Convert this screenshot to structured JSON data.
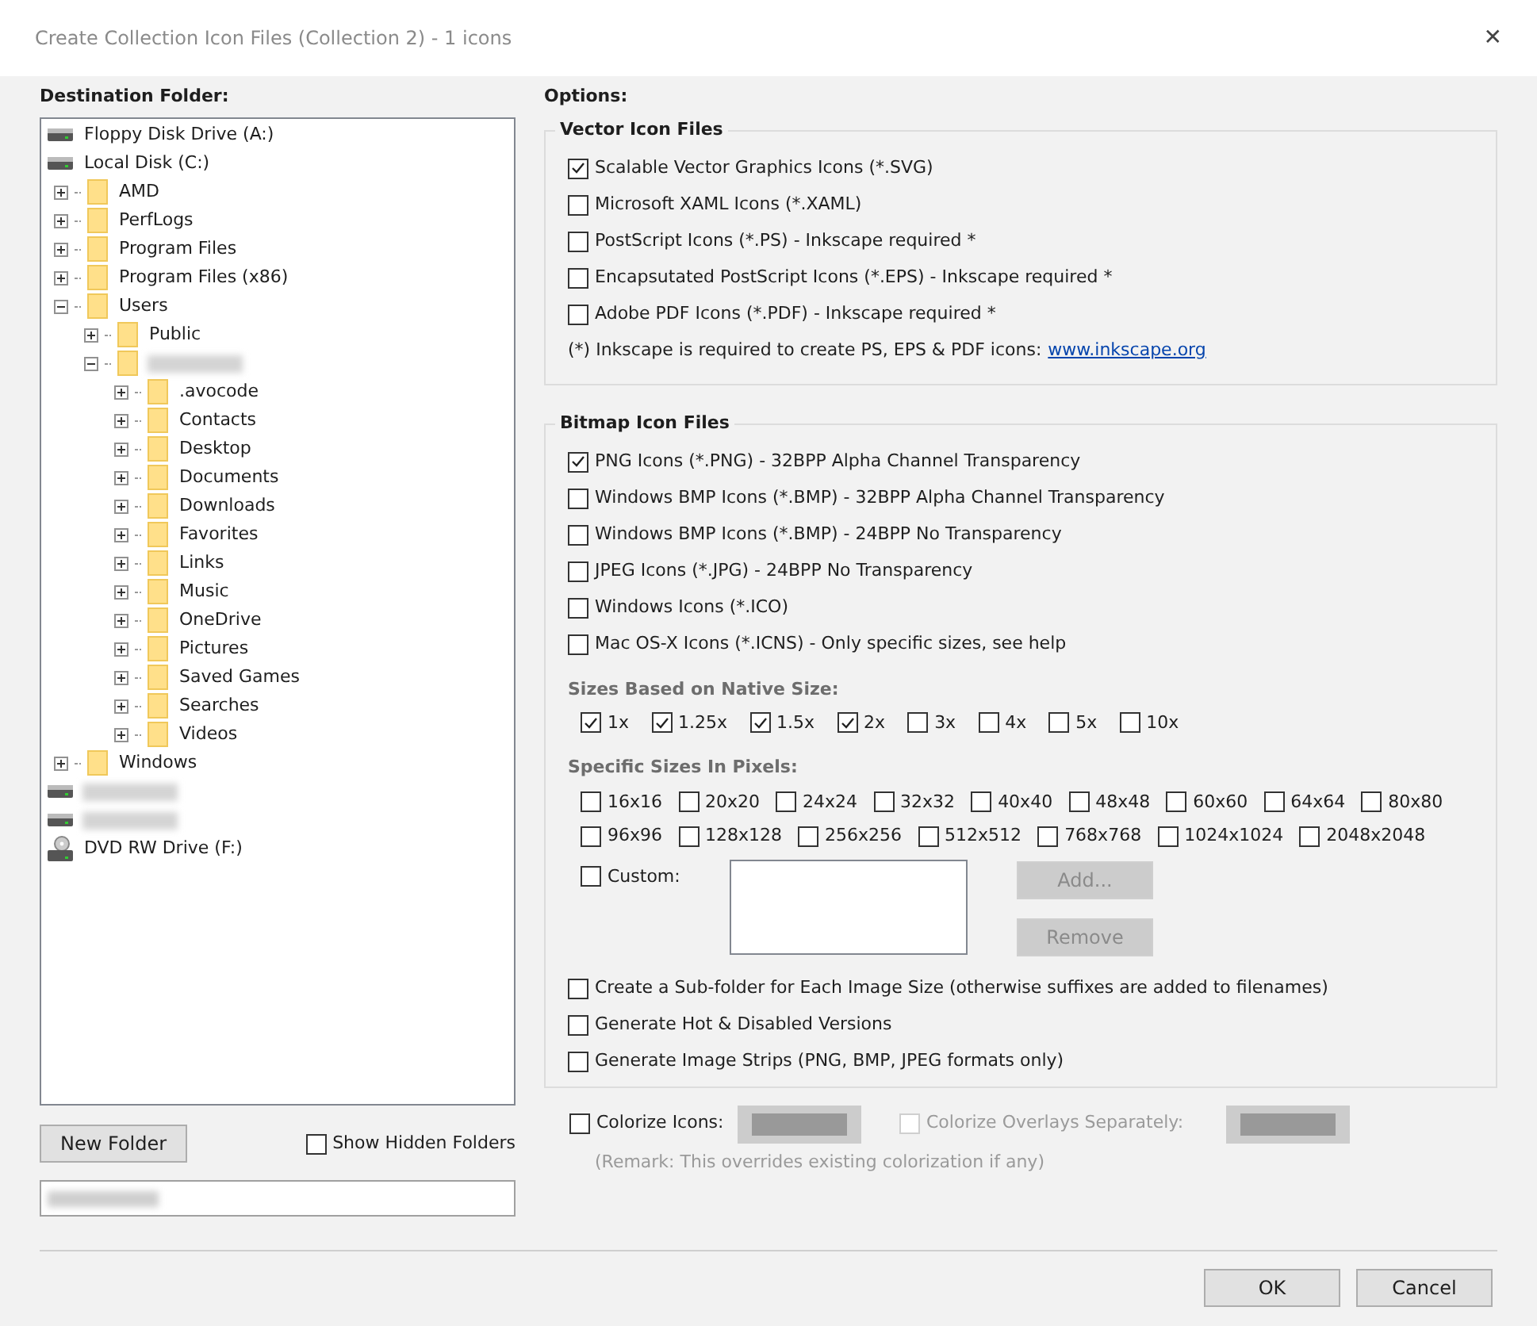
{
  "window": {
    "title": "Create Collection Icon Files (Collection 2) - 1 icons",
    "close": "✕"
  },
  "destination": {
    "label": "Destination Folder:",
    "tree": [
      {
        "kind": "drive",
        "label": "Floppy Disk Drive (A:)"
      },
      {
        "kind": "drive",
        "label": "Local Disk (C:)",
        "children": [
          {
            "kind": "folder",
            "label": "AMD",
            "expanded": false
          },
          {
            "kind": "folder",
            "label": "PerfLogs",
            "expanded": false
          },
          {
            "kind": "folder",
            "label": "Program Files",
            "expanded": false
          },
          {
            "kind": "folder",
            "label": "Program Files (x86)",
            "expanded": false
          },
          {
            "kind": "folder",
            "label": "Users",
            "expanded": true,
            "children": [
              {
                "kind": "folder",
                "label": "Public",
                "expanded": false
              },
              {
                "kind": "folder",
                "redacted": true,
                "expanded": true,
                "children": [
                  {
                    "kind": "folder",
                    "label": ".avocode",
                    "expanded": false
                  },
                  {
                    "kind": "folder",
                    "label": "Contacts",
                    "expanded": false
                  },
                  {
                    "kind": "folder",
                    "label": "Desktop",
                    "expanded": false
                  },
                  {
                    "kind": "folder",
                    "label": "Documents",
                    "expanded": false
                  },
                  {
                    "kind": "folder",
                    "label": "Downloads",
                    "expanded": false
                  },
                  {
                    "kind": "folder",
                    "label": "Favorites",
                    "expanded": false
                  },
                  {
                    "kind": "folder",
                    "label": "Links",
                    "expanded": false
                  },
                  {
                    "kind": "folder",
                    "label": "Music",
                    "expanded": false
                  },
                  {
                    "kind": "folder",
                    "label": "OneDrive",
                    "expanded": false
                  },
                  {
                    "kind": "folder",
                    "label": "Pictures",
                    "expanded": false
                  },
                  {
                    "kind": "folder",
                    "label": "Saved Games",
                    "expanded": false
                  },
                  {
                    "kind": "folder",
                    "label": "Searches",
                    "expanded": false
                  },
                  {
                    "kind": "folder",
                    "label": "Videos",
                    "expanded": false
                  }
                ]
              }
            ]
          },
          {
            "kind": "folder",
            "label": "Windows",
            "expanded": false
          }
        ]
      },
      {
        "kind": "drive",
        "redacted": true
      },
      {
        "kind": "drive",
        "redacted": true
      },
      {
        "kind": "dvd",
        "label": "DVD RW Drive (F:)"
      }
    ],
    "new_folder": "New Folder",
    "show_hidden": {
      "label": "Show Hidden Folders",
      "checked": false
    },
    "path": {
      "redacted": true
    }
  },
  "options": {
    "label": "Options:",
    "vector": {
      "title": "Vector Icon Files",
      "items": [
        {
          "label": "Scalable Vector Graphics Icons (*.SVG)",
          "checked": true
        },
        {
          "label": "Microsoft XAML Icons (*.XAML)",
          "checked": false
        },
        {
          "label": "PostScript Icons (*.PS) - Inkscape required *",
          "checked": false
        },
        {
          "label": "Encapsutated PostScript Icons (*.EPS) - Inkscape required *",
          "checked": false
        },
        {
          "label": "Adobe PDF Icons (*.PDF) - Inkscape required *",
          "checked": false
        }
      ],
      "note": "(*) Inkscape is required to create PS, EPS & PDF icons:",
      "link": "www.inkscape.org"
    },
    "bitmap": {
      "title": "Bitmap Icon Files",
      "items": [
        {
          "label": "PNG Icons (*.PNG) - 32BPP Alpha Channel Transparency",
          "checked": true
        },
        {
          "label": "Windows BMP Icons (*.BMP) - 32BPP Alpha Channel Transparency",
          "checked": false
        },
        {
          "label": "Windows BMP Icons (*.BMP) - 24BPP No Transparency",
          "checked": false
        },
        {
          "label": "JPEG Icons (*.JPG) - 24BPP No Transparency",
          "checked": false
        },
        {
          "label": "Windows Icons (*.ICO)",
          "checked": false
        },
        {
          "label": "Mac OS-X Icons (*.ICNS) - Only specific sizes, see help",
          "checked": false
        }
      ],
      "native_label": "Sizes Based on Native Size:",
      "native": [
        {
          "label": "1x",
          "checked": true
        },
        {
          "label": "1.25x",
          "checked": true
        },
        {
          "label": "1.5x",
          "checked": true
        },
        {
          "label": "2x",
          "checked": true
        },
        {
          "label": "3x",
          "checked": false
        },
        {
          "label": "4x",
          "checked": false
        },
        {
          "label": "5x",
          "checked": false
        },
        {
          "label": "10x",
          "checked": false
        }
      ],
      "specific_label": "Specific Sizes In Pixels:",
      "specific_rows": [
        [
          {
            "label": "16x16",
            "checked": false
          },
          {
            "label": "20x20",
            "checked": false
          },
          {
            "label": "24x24",
            "checked": false
          },
          {
            "label": "32x32",
            "checked": false
          },
          {
            "label": "40x40",
            "checked": false
          },
          {
            "label": "48x48",
            "checked": false
          },
          {
            "label": "60x60",
            "checked": false
          },
          {
            "label": "64x64",
            "checked": false
          },
          {
            "label": "80x80",
            "checked": false
          }
        ],
        [
          {
            "label": "96x96",
            "checked": false
          },
          {
            "label": "128x128",
            "checked": false
          },
          {
            "label": "256x256",
            "checked": false
          },
          {
            "label": "512x512",
            "checked": false
          },
          {
            "label": "768x768",
            "checked": false
          },
          {
            "label": "1024x1024",
            "checked": false
          },
          {
            "label": "2048x2048",
            "checked": false
          }
        ]
      ],
      "custom": {
        "label": "Custom:",
        "checked": false
      },
      "add": {
        "label": "Add...",
        "disabled": true
      },
      "remove": {
        "label": "Remove",
        "disabled": true
      },
      "extras": [
        {
          "label": "Create a Sub-folder for Each Image Size (otherwise suffixes are added to filenames)",
          "checked": false
        },
        {
          "label": "Generate Hot & Disabled Versions",
          "checked": false
        },
        {
          "label": "Generate Image Strips (PNG, BMP, JPEG formats only)",
          "checked": false
        }
      ]
    },
    "colorize": {
      "label": "Colorize Icons:",
      "checked": false,
      "disabled": false
    },
    "colorize_overlays": {
      "label": "Colorize Overlays Separately:",
      "checked": false,
      "disabled": true
    },
    "remark": "(Remark: This overrides existing colorization if any)"
  },
  "buttons": [
    {
      "label": "OK"
    },
    {
      "label": "Cancel"
    }
  ]
}
